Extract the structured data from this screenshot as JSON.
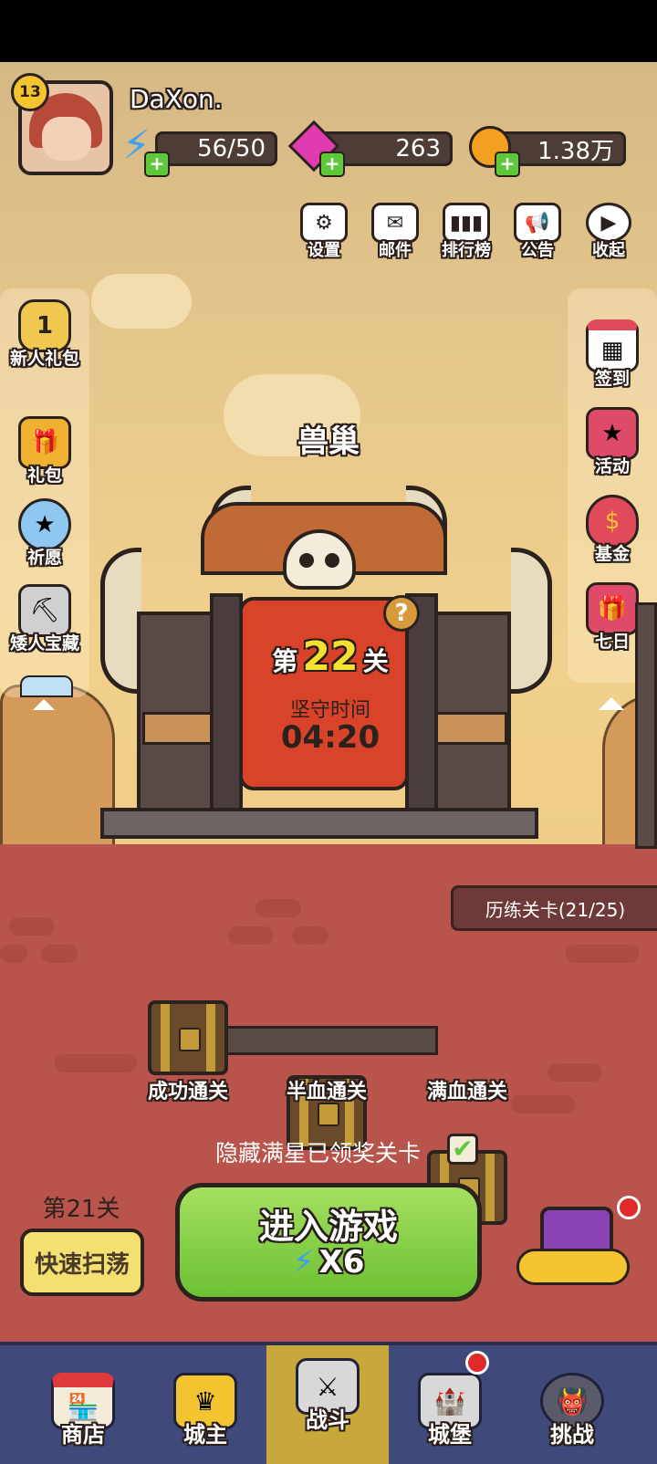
{
  "player": {
    "name": "DaXon.",
    "level": "13"
  },
  "resources": {
    "energy": "56/50",
    "gems": "263",
    "coins": "1.38万"
  },
  "top_menu": [
    {
      "label": "设置",
      "icon": "gear-icon"
    },
    {
      "label": "邮件",
      "icon": "mail-icon"
    },
    {
      "label": "排行榜",
      "icon": "leaderboard-icon"
    },
    {
      "label": "公告",
      "icon": "megaphone-icon"
    },
    {
      "label": "收起",
      "icon": "collapse-icon"
    }
  ],
  "left_menu": [
    {
      "label": "新人礼包",
      "badge": "1",
      "icon": "pentagon-badge-icon"
    },
    {
      "label": "礼包",
      "icon": "gift-icon"
    },
    {
      "label": "祈愿",
      "icon": "wish-star-icon"
    },
    {
      "label": "矮人宝藏",
      "icon": "pickaxe-icon"
    }
  ],
  "right_menu": [
    {
      "label": "签到",
      "icon": "calendar-icon"
    },
    {
      "label": "活动",
      "icon": "stars-gift-icon"
    },
    {
      "label": "基金",
      "icon": "money-bag-icon"
    },
    {
      "label": "七日",
      "icon": "gift-box-icon"
    }
  ],
  "stage": {
    "location": "兽巢",
    "prefix": "第",
    "number": "22",
    "suffix": "关",
    "hold_label": "坚守时间",
    "hold_time": "04:20",
    "help": "?"
  },
  "training": "历练关卡(21/25)",
  "chests": [
    "成功通关",
    "半血通关",
    "满血通关"
  ],
  "hide_starred": "隐藏满星已领奖关卡",
  "sweep": {
    "level": "第21关",
    "button": "快速扫荡"
  },
  "enter": {
    "label": "进入游戏",
    "cost": "X6"
  },
  "nav": [
    "商店",
    "城主",
    "战斗",
    "城堡",
    "挑战"
  ],
  "colors": {
    "ground": "#b8544b",
    "enter_button": "#7ccf3c",
    "nav_bg": "#3f4a7a",
    "nav_active": "#c8a83a",
    "gate_sign": "#d9432a"
  }
}
